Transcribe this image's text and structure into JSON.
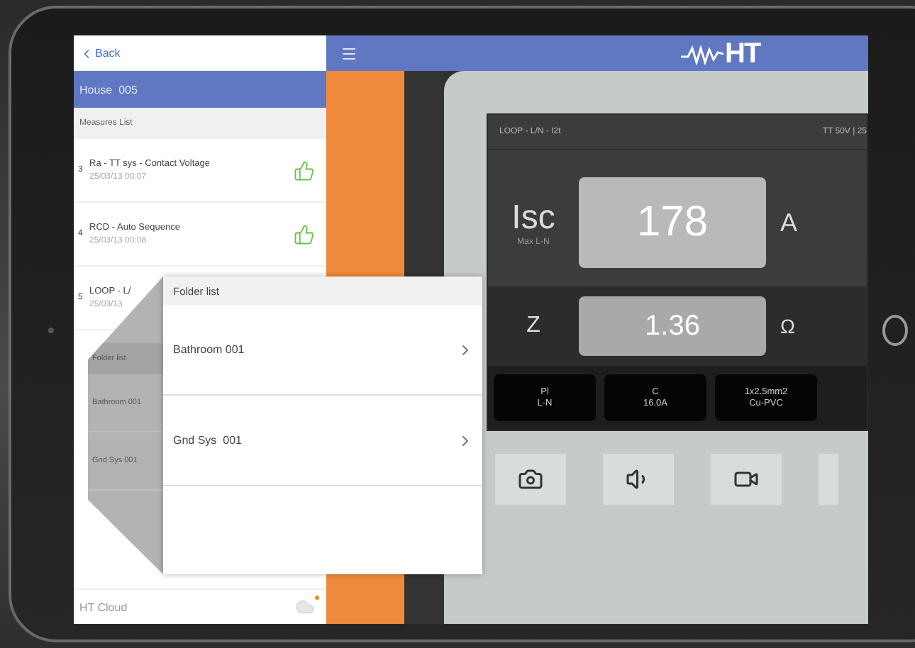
{
  "back": "Back",
  "left_header": "House  005",
  "section": "Measures List",
  "measures": [
    {
      "number": "3",
      "title": "Ra - TT sys - Contact Voltage",
      "date": "25/03/13 00:07",
      "passed": true
    },
    {
      "number": "4",
      "title": "RCD - Auto Sequence",
      "date": "25/03/13 00:08",
      "passed": true
    },
    {
      "number": "5",
      "title": "LOOP - L/",
      "date": "25/03/13"
    }
  ],
  "folded_page": {
    "title": "Folder list",
    "items": [
      "Bathroom 001",
      "Gnd Sys 001"
    ]
  },
  "folder_popup": {
    "title": "Folder list",
    "items": [
      "Bathroom 001",
      "Gnd Sys  001"
    ]
  },
  "cloud": {
    "label": "HT Cloud",
    "notification": true
  },
  "logo": "HT",
  "display": {
    "mode": "LOOP - L/N - I2t",
    "settings": "TT 50V | 25",
    "readings": [
      {
        "kind": "primary",
        "label": "Isc",
        "sublabel": "Max L-N",
        "value": "178",
        "unit": "A"
      },
      {
        "kind": "secondary",
        "label": "Z",
        "value": "1.36",
        "unit": "Ω"
      }
    ],
    "params": [
      {
        "top": "Pl",
        "bottom": "L-N"
      },
      {
        "top": "C",
        "bottom": "16.0A"
      },
      {
        "top": "1x2.5mm2",
        "bottom": "Cu-PVC"
      }
    ]
  },
  "actions": [
    {
      "kind": "camera"
    },
    {
      "kind": "speaker"
    },
    {
      "kind": "video"
    },
    {
      "kind": "partial"
    }
  ]
}
